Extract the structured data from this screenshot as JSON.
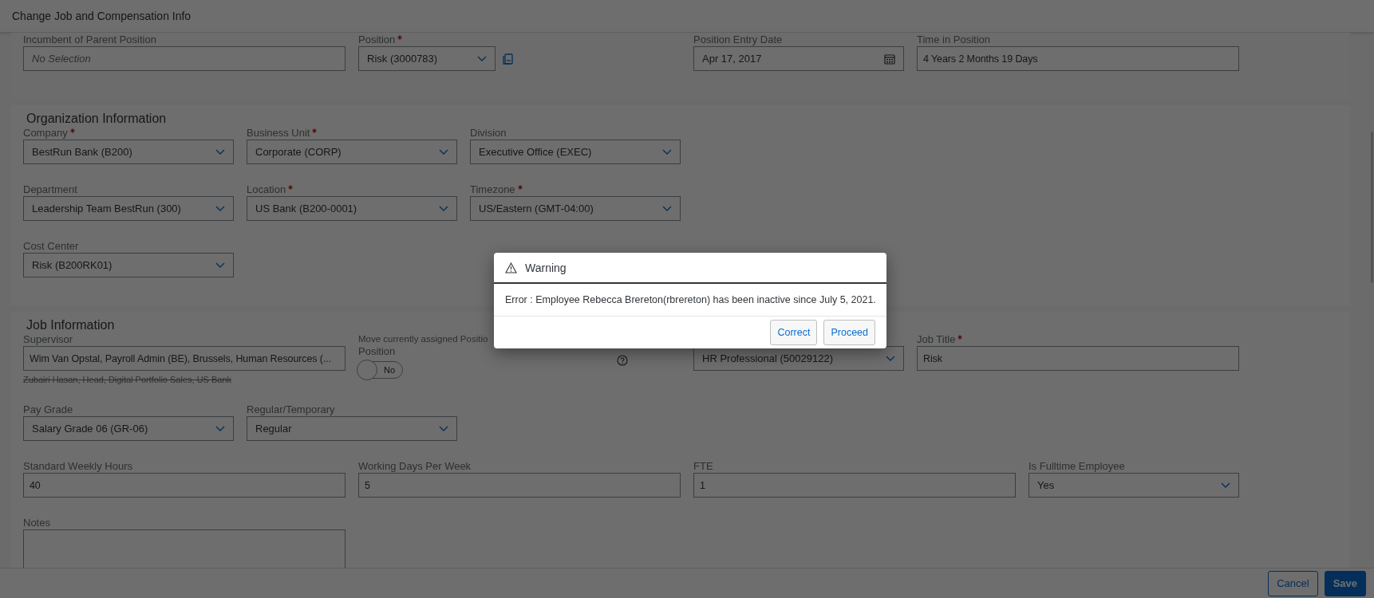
{
  "window": {
    "title": "Change Job and Compensation Info"
  },
  "sections": [
    {
      "rows": [
        {
          "fields": [
            {
              "kind": "text",
              "label": "Incumbent of Parent Position",
              "required": false,
              "placeholder": "No Selection"
            },
            {
              "kind": "select-copy",
              "label": "Position",
              "required": true,
              "value": "Risk (3000783)"
            },
            {
              "kind": "date",
              "label": "Position Entry Date",
              "required": false,
              "value": "Apr 17, 2017"
            },
            {
              "kind": "text",
              "label": "Time in Position",
              "required": false,
              "value": "4 Years 2 Months 19 Days"
            }
          ]
        }
      ]
    },
    {
      "heading": "Organization Information",
      "rows": [
        {
          "fields": [
            {
              "kind": "select",
              "label": "Company",
              "required": true,
              "value": "BestRun Bank (B200)"
            },
            {
              "kind": "select",
              "label": "Business Unit",
              "required": true,
              "value": "Corporate (CORP)"
            },
            {
              "kind": "select",
              "label": "Division",
              "required": false,
              "value": "Executive Office (EXEC)"
            }
          ]
        },
        {
          "fields": [
            {
              "kind": "select",
              "label": "Department",
              "required": false,
              "value": "Leadership Team BestRun (300)"
            },
            {
              "kind": "select",
              "label": "Location",
              "required": true,
              "value": "US Bank (B200-0001)"
            },
            {
              "kind": "select",
              "label": "Timezone",
              "required": true,
              "value": "US/Eastern (GMT-04:00)"
            }
          ]
        },
        {
          "fields": [
            {
              "kind": "select",
              "label": "Cost Center",
              "required": false,
              "value": "Risk (B200RK01)"
            }
          ]
        }
      ]
    },
    {
      "heading": "Job Information",
      "rows": [
        {
          "fields": [
            {
              "kind": "text",
              "label": "Supervisor",
              "required": false,
              "value": "Wim Van Opstal, Payroll Admin (BE), Brussels, Human Resources (...",
              "previous_value": "Zubairi Hasan, Head, Digital Portfolio Sales, US Bank"
            },
            {
              "kind": "toggle",
              "label": "Move currently assigned Positio",
              "label_line_2": "Position",
              "required": false,
              "on": false,
              "toggle_text": "No"
            },
            {
              "kind": "select",
              "required": false,
              "value": "HR Professional (50029122)"
            },
            {
              "kind": "text",
              "label": "Job Title",
              "required": true,
              "value": "Risk"
            }
          ]
        },
        {
          "fields": [
            {
              "kind": "select",
              "label": "Pay Grade",
              "required": false,
              "value": "Salary Grade 06 (GR-06)"
            },
            {
              "kind": "select",
              "label": "Regular/Temporary",
              "required": false,
              "value": "Regular"
            }
          ]
        },
        {
          "fields": [
            {
              "kind": "text",
              "label": "Standard Weekly Hours",
              "required": false,
              "value": "40"
            },
            {
              "kind": "text",
              "label": "Working Days Per Week",
              "required": false,
              "value": "5"
            },
            {
              "kind": "text",
              "label": "FTE",
              "required": false,
              "value": "1"
            },
            {
              "kind": "select",
              "label": "Is Fulltime Employee",
              "required": false,
              "value": "Yes"
            }
          ]
        },
        {
          "fields": [
            {
              "kind": "textarea",
              "label": "Notes",
              "required": false
            }
          ]
        }
      ]
    }
  ],
  "footer": {
    "buttons": [
      {
        "label": "Cancel",
        "kind": "secondary"
      },
      {
        "label": "Save",
        "kind": "primary"
      }
    ]
  },
  "dialog": {
    "title": "Warning",
    "message": "Error : Employee Rebecca Brereton(rbrereton) has been inactive since July 5, 2021.",
    "buttons": [
      {
        "label": "Correct"
      },
      {
        "label": "Proceed"
      }
    ]
  }
}
